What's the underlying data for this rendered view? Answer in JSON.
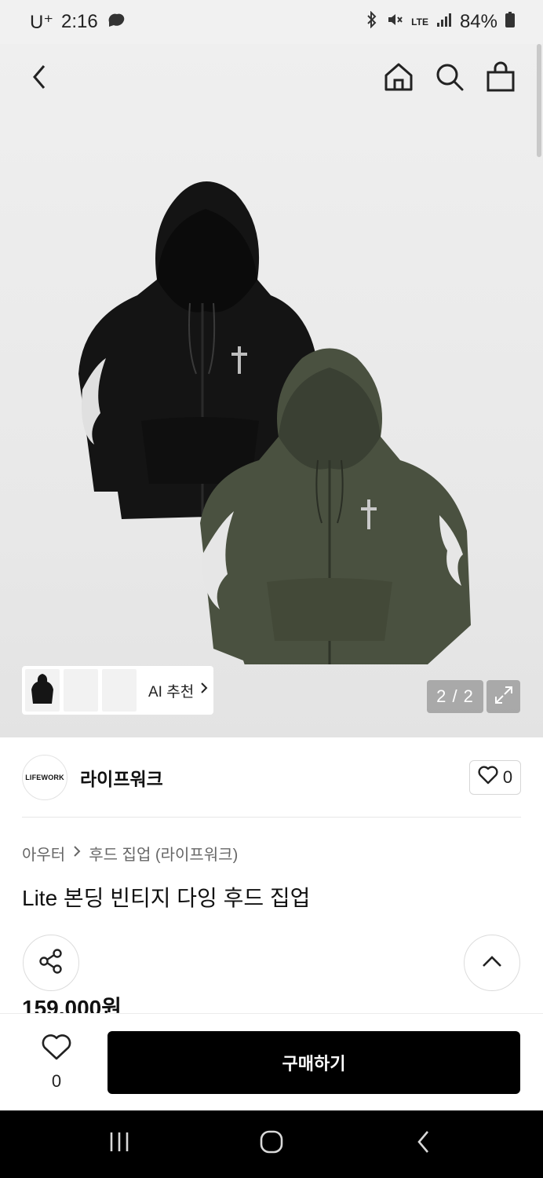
{
  "status_bar": {
    "carrier": "U⁺",
    "time": "2:16",
    "network": "LTE",
    "battery": "84%"
  },
  "gallery": {
    "page_indicator": "2 / 2",
    "ai_recommend_label": "AI 추천"
  },
  "brand": {
    "logo_text": "LIFEWORK",
    "name": "라이프워크",
    "like_count": "0"
  },
  "breadcrumb": {
    "category": "아우터",
    "subcategory": "후드 집업 (라이프워크)"
  },
  "product": {
    "title": "Lite 본딩 빈티지 다잉 후드 집업",
    "price": "159,000원"
  },
  "bottom_bar": {
    "wish_count": "0",
    "buy_label": "구매하기"
  },
  "colors": {
    "hoodie_black": "#141414",
    "hoodie_olive": "#4a5140",
    "buy_button": "#000000"
  }
}
